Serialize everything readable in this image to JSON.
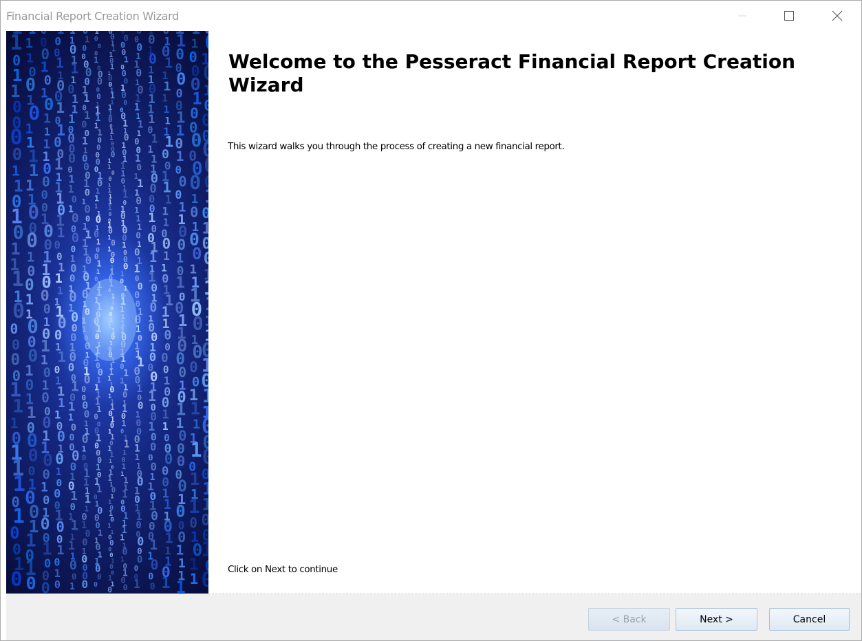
{
  "window": {
    "title": "Financial Report Creation Wizard"
  },
  "controls": {
    "minimize_icon": "minimize-icon",
    "maximize_icon": "maximize-icon",
    "close_icon": "close-icon"
  },
  "banner": {
    "image": "binary-code-tunnel",
    "colors": {
      "dark": "#070b35",
      "mid": "#14267e",
      "bright": "#2a4fd8",
      "glow": "#96c8ff"
    }
  },
  "main": {
    "heading": "Welcome to the Pesseract Financial Report Creation Wizard",
    "intro": "This wizard walks you through the process of creating a new financial report.",
    "continue_hint": "Click on Next to continue"
  },
  "footer": {
    "back_label": "< Back",
    "next_label": "Next >",
    "cancel_label": "Cancel",
    "back_enabled": false
  }
}
